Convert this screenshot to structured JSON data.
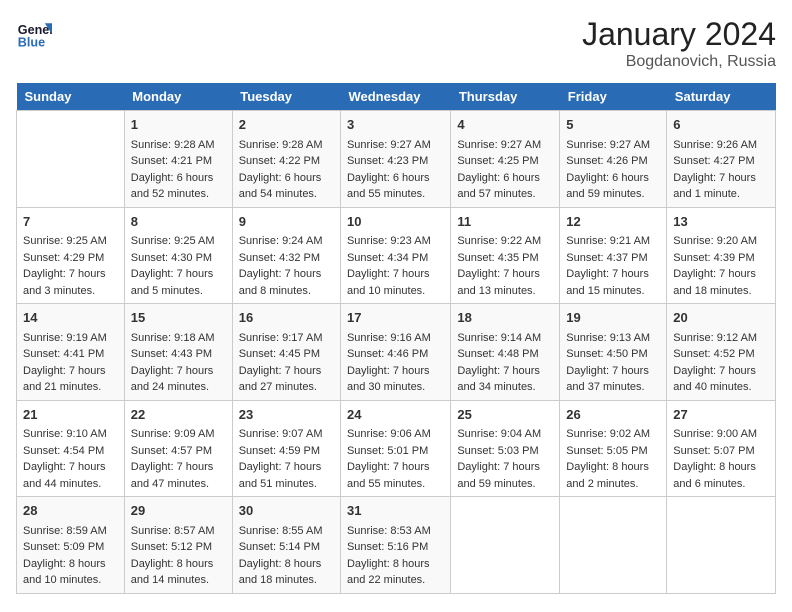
{
  "header": {
    "logo_line1": "General",
    "logo_line2": "Blue",
    "month_year": "January 2024",
    "location": "Bogdanovich, Russia"
  },
  "columns": [
    "Sunday",
    "Monday",
    "Tuesday",
    "Wednesday",
    "Thursday",
    "Friday",
    "Saturday"
  ],
  "weeks": [
    [
      {
        "day": "",
        "sunrise": "",
        "sunset": "",
        "daylight": ""
      },
      {
        "day": "1",
        "sunrise": "Sunrise: 9:28 AM",
        "sunset": "Sunset: 4:21 PM",
        "daylight": "Daylight: 6 hours and 52 minutes."
      },
      {
        "day": "2",
        "sunrise": "Sunrise: 9:28 AM",
        "sunset": "Sunset: 4:22 PM",
        "daylight": "Daylight: 6 hours and 54 minutes."
      },
      {
        "day": "3",
        "sunrise": "Sunrise: 9:27 AM",
        "sunset": "Sunset: 4:23 PM",
        "daylight": "Daylight: 6 hours and 55 minutes."
      },
      {
        "day": "4",
        "sunrise": "Sunrise: 9:27 AM",
        "sunset": "Sunset: 4:25 PM",
        "daylight": "Daylight: 6 hours and 57 minutes."
      },
      {
        "day": "5",
        "sunrise": "Sunrise: 9:27 AM",
        "sunset": "Sunset: 4:26 PM",
        "daylight": "Daylight: 6 hours and 59 minutes."
      },
      {
        "day": "6",
        "sunrise": "Sunrise: 9:26 AM",
        "sunset": "Sunset: 4:27 PM",
        "daylight": "Daylight: 7 hours and 1 minute."
      }
    ],
    [
      {
        "day": "7",
        "sunrise": "Sunrise: 9:25 AM",
        "sunset": "Sunset: 4:29 PM",
        "daylight": "Daylight: 7 hours and 3 minutes."
      },
      {
        "day": "8",
        "sunrise": "Sunrise: 9:25 AM",
        "sunset": "Sunset: 4:30 PM",
        "daylight": "Daylight: 7 hours and 5 minutes."
      },
      {
        "day": "9",
        "sunrise": "Sunrise: 9:24 AM",
        "sunset": "Sunset: 4:32 PM",
        "daylight": "Daylight: 7 hours and 8 minutes."
      },
      {
        "day": "10",
        "sunrise": "Sunrise: 9:23 AM",
        "sunset": "Sunset: 4:34 PM",
        "daylight": "Daylight: 7 hours and 10 minutes."
      },
      {
        "day": "11",
        "sunrise": "Sunrise: 9:22 AM",
        "sunset": "Sunset: 4:35 PM",
        "daylight": "Daylight: 7 hours and 13 minutes."
      },
      {
        "day": "12",
        "sunrise": "Sunrise: 9:21 AM",
        "sunset": "Sunset: 4:37 PM",
        "daylight": "Daylight: 7 hours and 15 minutes."
      },
      {
        "day": "13",
        "sunrise": "Sunrise: 9:20 AM",
        "sunset": "Sunset: 4:39 PM",
        "daylight": "Daylight: 7 hours and 18 minutes."
      }
    ],
    [
      {
        "day": "14",
        "sunrise": "Sunrise: 9:19 AM",
        "sunset": "Sunset: 4:41 PM",
        "daylight": "Daylight: 7 hours and 21 minutes."
      },
      {
        "day": "15",
        "sunrise": "Sunrise: 9:18 AM",
        "sunset": "Sunset: 4:43 PM",
        "daylight": "Daylight: 7 hours and 24 minutes."
      },
      {
        "day": "16",
        "sunrise": "Sunrise: 9:17 AM",
        "sunset": "Sunset: 4:45 PM",
        "daylight": "Daylight: 7 hours and 27 minutes."
      },
      {
        "day": "17",
        "sunrise": "Sunrise: 9:16 AM",
        "sunset": "Sunset: 4:46 PM",
        "daylight": "Daylight: 7 hours and 30 minutes."
      },
      {
        "day": "18",
        "sunrise": "Sunrise: 9:14 AM",
        "sunset": "Sunset: 4:48 PM",
        "daylight": "Daylight: 7 hours and 34 minutes."
      },
      {
        "day": "19",
        "sunrise": "Sunrise: 9:13 AM",
        "sunset": "Sunset: 4:50 PM",
        "daylight": "Daylight: 7 hours and 37 minutes."
      },
      {
        "day": "20",
        "sunrise": "Sunrise: 9:12 AM",
        "sunset": "Sunset: 4:52 PM",
        "daylight": "Daylight: 7 hours and 40 minutes."
      }
    ],
    [
      {
        "day": "21",
        "sunrise": "Sunrise: 9:10 AM",
        "sunset": "Sunset: 4:54 PM",
        "daylight": "Daylight: 7 hours and 44 minutes."
      },
      {
        "day": "22",
        "sunrise": "Sunrise: 9:09 AM",
        "sunset": "Sunset: 4:57 PM",
        "daylight": "Daylight: 7 hours and 47 minutes."
      },
      {
        "day": "23",
        "sunrise": "Sunrise: 9:07 AM",
        "sunset": "Sunset: 4:59 PM",
        "daylight": "Daylight: 7 hours and 51 minutes."
      },
      {
        "day": "24",
        "sunrise": "Sunrise: 9:06 AM",
        "sunset": "Sunset: 5:01 PM",
        "daylight": "Daylight: 7 hours and 55 minutes."
      },
      {
        "day": "25",
        "sunrise": "Sunrise: 9:04 AM",
        "sunset": "Sunset: 5:03 PM",
        "daylight": "Daylight: 7 hours and 59 minutes."
      },
      {
        "day": "26",
        "sunrise": "Sunrise: 9:02 AM",
        "sunset": "Sunset: 5:05 PM",
        "daylight": "Daylight: 8 hours and 2 minutes."
      },
      {
        "day": "27",
        "sunrise": "Sunrise: 9:00 AM",
        "sunset": "Sunset: 5:07 PM",
        "daylight": "Daylight: 8 hours and 6 minutes."
      }
    ],
    [
      {
        "day": "28",
        "sunrise": "Sunrise: 8:59 AM",
        "sunset": "Sunset: 5:09 PM",
        "daylight": "Daylight: 8 hours and 10 minutes."
      },
      {
        "day": "29",
        "sunrise": "Sunrise: 8:57 AM",
        "sunset": "Sunset: 5:12 PM",
        "daylight": "Daylight: 8 hours and 14 minutes."
      },
      {
        "day": "30",
        "sunrise": "Sunrise: 8:55 AM",
        "sunset": "Sunset: 5:14 PM",
        "daylight": "Daylight: 8 hours and 18 minutes."
      },
      {
        "day": "31",
        "sunrise": "Sunrise: 8:53 AM",
        "sunset": "Sunset: 5:16 PM",
        "daylight": "Daylight: 8 hours and 22 minutes."
      },
      {
        "day": "",
        "sunrise": "",
        "sunset": "",
        "daylight": ""
      },
      {
        "day": "",
        "sunrise": "",
        "sunset": "",
        "daylight": ""
      },
      {
        "day": "",
        "sunrise": "",
        "sunset": "",
        "daylight": ""
      }
    ]
  ]
}
